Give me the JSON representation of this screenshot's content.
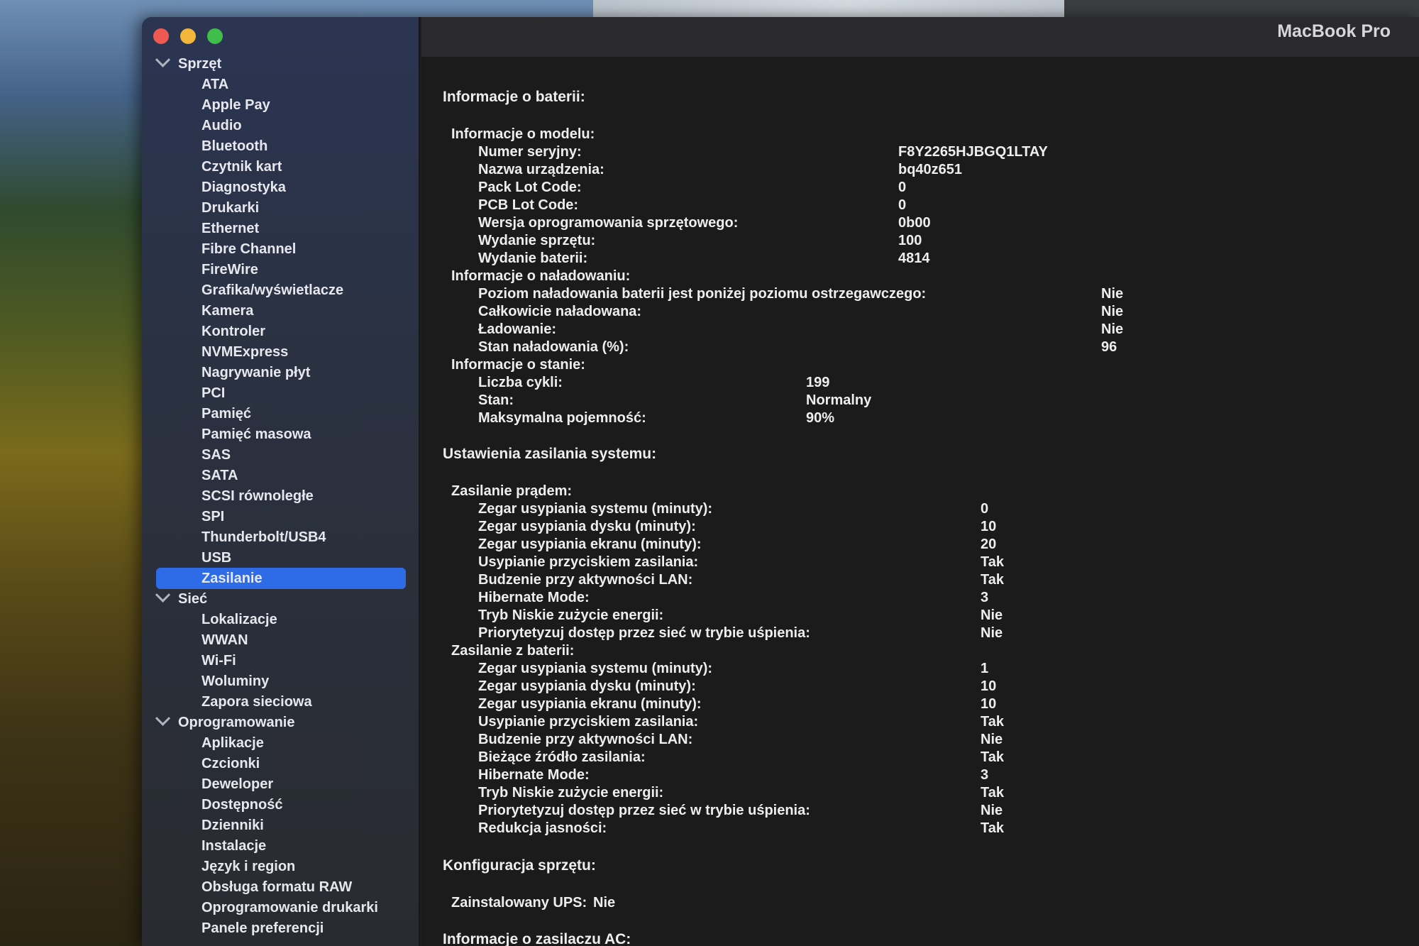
{
  "window": {
    "title": "MacBook Pro"
  },
  "sidebar": {
    "groups": [
      {
        "label": "Sprzęt",
        "items": [
          "ATA",
          "Apple Pay",
          "Audio",
          "Bluetooth",
          "Czytnik kart",
          "Diagnostyka",
          "Drukarki",
          "Ethernet",
          "Fibre Channel",
          "FireWire",
          "Grafika/wyświetlacze",
          "Kamera",
          "Kontroler",
          "NVMExpress",
          "Nagrywanie płyt",
          "PCI",
          "Pamięć",
          "Pamięć masowa",
          "SAS",
          "SATA",
          "SCSI równoległe",
          "SPI",
          "Thunderbolt/USB4",
          "USB",
          "Zasilanie"
        ]
      },
      {
        "label": "Sieć",
        "items": [
          "Lokalizacje",
          "WWAN",
          "Wi-Fi",
          "Woluminy",
          "Zapora sieciowa"
        ]
      },
      {
        "label": "Oprogramowanie",
        "items": [
          "Aplikacje",
          "Czcionki",
          "Deweloper",
          "Dostępność",
          "Dzienniki",
          "Instalacje",
          "Język i region",
          "Obsługa formatu RAW",
          "Oprogramowanie drukarki",
          "Panele preferencji"
        ]
      }
    ],
    "selected": "Zasilanie"
  },
  "battery": {
    "heading": "Informacje o baterii:",
    "model": {
      "label": "Informacje o modelu:",
      "rows": [
        {
          "k": "Numer seryjny:",
          "v": "F8Y2265HJBGQ1LTAY"
        },
        {
          "k": "Nazwa urządzenia:",
          "v": "bq40z651"
        },
        {
          "k": "Pack Lot Code:",
          "v": "0"
        },
        {
          "k": "PCB Lot Code:",
          "v": "0"
        },
        {
          "k": "Wersja oprogramowania sprzętowego:",
          "v": "0b00"
        },
        {
          "k": "Wydanie sprzętu:",
          "v": "100"
        },
        {
          "k": "Wydanie baterii:",
          "v": "4814"
        }
      ]
    },
    "charge": {
      "label": "Informacje o naładowaniu:",
      "rows": [
        {
          "k": "Poziom naładowania baterii jest poniżej poziomu ostrzegawczego:",
          "v": "Nie"
        },
        {
          "k": "Całkowicie naładowana:",
          "v": "Nie"
        },
        {
          "k": "Ładowanie:",
          "v": "Nie"
        },
        {
          "k": "Stan naładowania (%):",
          "v": "96"
        }
      ]
    },
    "health": {
      "label": "Informacje o stanie:",
      "rows": [
        {
          "k": "Liczba cykli:",
          "v": "199"
        },
        {
          "k": "Stan:",
          "v": "Normalny"
        },
        {
          "k": "Maksymalna pojemność:",
          "v": "90%"
        }
      ]
    }
  },
  "power": {
    "heading": "Ustawienia zasilania systemu:",
    "ac": {
      "label": "Zasilanie prądem:",
      "rows": [
        {
          "k": "Zegar usypiania systemu (minuty):",
          "v": "0"
        },
        {
          "k": "Zegar usypiania dysku (minuty):",
          "v": "10"
        },
        {
          "k": "Zegar usypiania ekranu (minuty):",
          "v": "20"
        },
        {
          "k": "Usypianie przyciskiem zasilania:",
          "v": "Tak"
        },
        {
          "k": "Budzenie przy aktywności LAN:",
          "v": "Tak"
        },
        {
          "k": "Hibernate Mode:",
          "v": "3"
        },
        {
          "k": "Tryb Niskie zużycie energii:",
          "v": "Nie"
        },
        {
          "k": "Priorytetyzuj dostęp przez sieć w trybie uśpienia:",
          "v": "Nie"
        }
      ]
    },
    "battery": {
      "label": "Zasilanie z baterii:",
      "rows": [
        {
          "k": "Zegar usypiania systemu (minuty):",
          "v": "1"
        },
        {
          "k": "Zegar usypiania dysku (minuty):",
          "v": "10"
        },
        {
          "k": "Zegar usypiania ekranu (minuty):",
          "v": "10"
        },
        {
          "k": "Usypianie przyciskiem zasilania:",
          "v": "Tak"
        },
        {
          "k": "Budzenie przy aktywności LAN:",
          "v": "Nie"
        },
        {
          "k": "Bieżące źródło zasilania:",
          "v": "Tak"
        },
        {
          "k": "Hibernate Mode:",
          "v": "3"
        },
        {
          "k": "Tryb Niskie zużycie energii:",
          "v": "Tak"
        },
        {
          "k": "Priorytetyzuj dostęp przez sieć w trybie uśpienia:",
          "v": "Nie"
        },
        {
          "k": "Redukcja jasności:",
          "v": "Tak"
        }
      ]
    }
  },
  "hardware_config": {
    "heading": "Konfiguracja sprzętu:",
    "ups_label": "Zainstalowany UPS:",
    "ups_value": "Nie"
  },
  "ac_info": {
    "heading": "Informacje o zasilaczu AC:"
  }
}
